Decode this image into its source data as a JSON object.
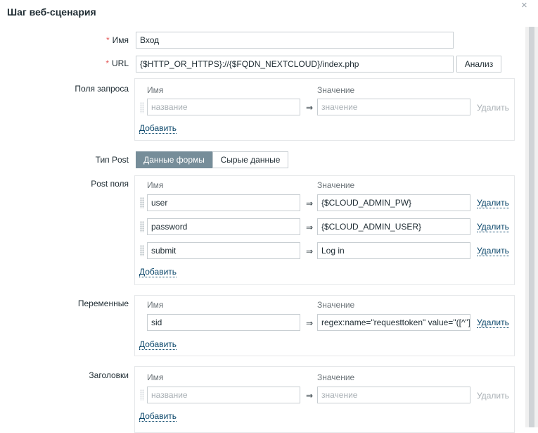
{
  "dialog": {
    "title": "Шаг веб-сценария",
    "close_glyph": "×"
  },
  "name": {
    "required_mark": "*",
    "label": "Имя",
    "value": "Вход"
  },
  "url": {
    "required_mark": "*",
    "label": "URL",
    "value": "{$HTTP_OR_HTTPS}://{$FQDN_NEXTCLOUD}/index.php",
    "parse_button": "Анализ"
  },
  "query_fields": {
    "label": "Поля запроса",
    "col_name": "Имя",
    "col_value": "Значение",
    "name_placeholder": "название",
    "value_placeholder": "значение",
    "remove": "Удалить",
    "add": "Добавить"
  },
  "post_type": {
    "label": "Тип Post",
    "form_data": "Данные формы",
    "raw_data": "Сырые данные"
  },
  "post_fields": {
    "label": "Post поля",
    "col_name": "Имя",
    "col_value": "Значение",
    "rows": [
      {
        "name": "user",
        "value": "{$CLOUD_ADMIN_PW}",
        "remove": "Удалить"
      },
      {
        "name": "password",
        "value": "{$CLOUD_ADMIN_USER}",
        "remove": "Удалить"
      },
      {
        "name": "submit",
        "value": "Log in",
        "remove": "Удалить"
      }
    ],
    "add": "Добавить"
  },
  "variables": {
    "label": "Переменные",
    "col_name": "Имя",
    "col_value": "Значение",
    "rows": [
      {
        "name": "sid",
        "value": "regex:name=\"requesttoken\" value=\"([^\"]+)\"",
        "remove": "Удалить"
      }
    ],
    "add": "Добавить"
  },
  "headers": {
    "label": "Заголовки",
    "col_name": "Имя",
    "col_value": "Значение",
    "name_placeholder": "название",
    "value_placeholder": "значение",
    "remove": "Удалить",
    "add": "Добавить"
  },
  "arrow_glyph": "⇒"
}
